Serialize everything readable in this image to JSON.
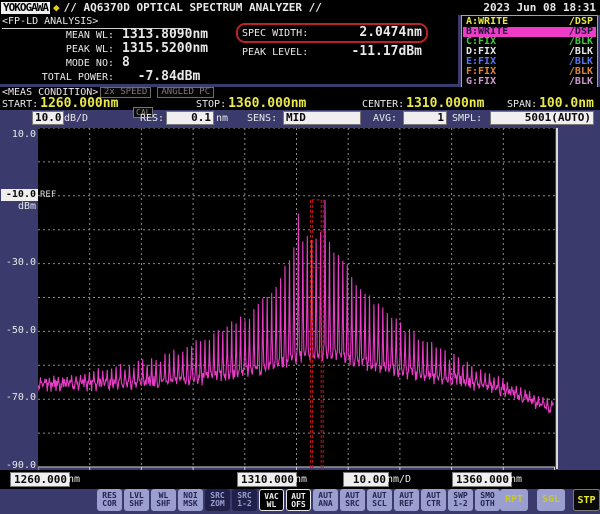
{
  "header": {
    "brand": "YOKOGAWA",
    "brand_diamond": "◆",
    "title": "// AQ6370D OPTICAL SPECTRUM ANALYZER //",
    "datetime": "2023 Jun 08 18:31"
  },
  "analysis": {
    "title": "<FP-LD ANALYSIS>",
    "fields_left": [
      {
        "label": "MEAN WL:",
        "value": "1313.8090nm"
      },
      {
        "label": "PEAK WL:",
        "value": "1315.5200nm"
      },
      {
        "label": "MODE NO:",
        "value": "8"
      },
      {
        "label": "TOTAL POWER:",
        "value": "  -7.84dBm"
      }
    ],
    "fields_right": [
      {
        "label": "SPEC WIDTH:",
        "value": "2.0474nm",
        "highlighted": true
      },
      {
        "label": "PEAK LEVEL:",
        "value": "-11.17dBm"
      }
    ],
    "highlight_color": "#b92222"
  },
  "trace_menu": {
    "items": [
      {
        "label": "A:WRITE",
        "mode": "/DSP",
        "color": "#e8e848"
      },
      {
        "label": "B:WRITE",
        "mode": "/DSP",
        "color": "#181838",
        "bg": "#ee3cc8",
        "active": true
      },
      {
        "label": "C:FIX",
        "mode": "/BLK",
        "color": "#3ecc3e"
      },
      {
        "label": "D:FIX",
        "mode": "/BLK",
        "color": "#e8e8e8"
      },
      {
        "label": "E:FIX",
        "mode": "/BLK",
        "color": "#5577ee"
      },
      {
        "label": "F:FIX",
        "mode": "/BLK",
        "color": "#dd8833"
      },
      {
        "label": "G:FIX",
        "mode": "/BLK",
        "color": "#cc99cc"
      }
    ]
  },
  "meas_condition": {
    "title": "<MEAS CONDITION>",
    "flags": [
      "2x SPEED",
      "ANGLED PC"
    ],
    "params": [
      {
        "label": "START:",
        "value": "1260.000nm"
      },
      {
        "label": "STOP:",
        "value": "1360.000nm"
      },
      {
        "label": "CENTER:",
        "value": "1310.000nm"
      },
      {
        "label": "SPAN:",
        "value": "100.0nm"
      }
    ]
  },
  "settings": {
    "level_scale_value": "10.0",
    "level_scale_unit": "dB/D",
    "cal_flag": "CAL",
    "res_label": "RES:",
    "res_value": "0.1",
    "res_unit": "nm",
    "sens_label": "SENS:",
    "sens_value": "MID",
    "avg_label": "AVG:",
    "avg_value": "1",
    "smpl_label": "SMPL:",
    "smpl_value": "5001(AUTO)"
  },
  "chart": {
    "y_axis_labels": [
      "10.0",
      "-10.0",
      "-30.0",
      "-50.0",
      "-70.0",
      "-90.0"
    ],
    "y_unit": "dBm",
    "ref_label": "REF"
  },
  "x_axis": {
    "start_value": "1260.000",
    "start_unit": "nm",
    "center_value": "1310.000",
    "center_unit": "nm",
    "per_div_value": "10.00",
    "per_div_unit": "nm/D",
    "stop_value": "1360.000",
    "stop_unit": "nm"
  },
  "softkeys": [
    {
      "l1": "RES",
      "l2": "COR",
      "state": "normal"
    },
    {
      "l1": "LVL",
      "l2": "SHF",
      "state": "normal"
    },
    {
      "l1": "WL",
      "l2": "SHF",
      "state": "normal"
    },
    {
      "l1": "NOI",
      "l2": "MSK",
      "state": "normal"
    },
    {
      "l1": "SRC",
      "l2": "ZOM",
      "state": "inverted"
    },
    {
      "l1": "SRC",
      "l2": "1-2",
      "state": "inverted"
    },
    {
      "l1": "VAC",
      "l2": "WL",
      "state": "selected"
    },
    {
      "l1": "AUT",
      "l2": "OFS",
      "state": "selected"
    },
    {
      "l1": "AUT",
      "l2": "ANA",
      "state": "normal"
    },
    {
      "l1": "AUT",
      "l2": "SRC",
      "state": "normal"
    },
    {
      "l1": "AUT",
      "l2": "SCL",
      "state": "normal"
    },
    {
      "l1": "AUT",
      "l2": "REF",
      "state": "normal"
    },
    {
      "l1": "AUT",
      "l2": "CTR",
      "state": "normal"
    },
    {
      "l1": "SWP",
      "l2": "1-2",
      "state": "normal"
    },
    {
      "l1": "SMO",
      "l2": "OTH",
      "state": "normal"
    }
  ],
  "sweep_keys": {
    "repeat": "RPT",
    "single": "SGL",
    "stop": "STP",
    "stop_active": true
  },
  "chart_data": {
    "type": "line",
    "title": "FP-LD optical spectrum, active trace B (WRITE)",
    "x_unit": "nm",
    "y_unit": "dBm",
    "x_range": [
      1260,
      1360
    ],
    "y_range": [
      -90,
      10
    ],
    "x_div_nm": 10,
    "y_div_db": 10,
    "ref_level_dbm": -10,
    "scale_db_per_div": 10,
    "grid": true,
    "trace_color": "#e93cc8",
    "grid_color": "#8a8a8a",
    "marker_color": "#cc1515",
    "peak": {
      "wl_nm": 1315.52,
      "level_dbm": -11.17
    },
    "mean_wl_nm": 1313.809,
    "spec_width_nm": 2.0474,
    "markers": {
      "left_nm": 1312.93,
      "right_nm": 1314.98,
      "top_dbm": -11.2,
      "threshold_dbm": -31.2
    },
    "comb": {
      "spacing_nm": 0.86,
      "anchor_nm": 1315.52
    },
    "envelope_points": [
      [
        1260,
        -64
      ],
      [
        1266,
        -63
      ],
      [
        1272,
        -61.5
      ],
      [
        1278,
        -60
      ],
      [
        1284,
        -57.5
      ],
      [
        1290,
        -54
      ],
      [
        1296,
        -50
      ],
      [
        1301,
        -45
      ],
      [
        1305,
        -39
      ],
      [
        1308,
        -31
      ],
      [
        1309.7,
        -25.5
      ],
      [
        1310.36,
        -16.2
      ],
      [
        1311,
        -23.5
      ],
      [
        1312,
        -22.5
      ],
      [
        1313,
        -21.5
      ],
      [
        1314,
        -21.8
      ],
      [
        1314.9,
        -19.5
      ],
      [
        1315.52,
        -11.17
      ],
      [
        1316.3,
        -23.5
      ],
      [
        1317.5,
        -26.5
      ],
      [
        1319,
        -30
      ],
      [
        1321,
        -34
      ],
      [
        1324,
        -39
      ],
      [
        1328,
        -45
      ],
      [
        1332,
        -50
      ],
      [
        1336,
        -54
      ],
      [
        1340,
        -57.5
      ],
      [
        1344,
        -60.5
      ],
      [
        1348,
        -63
      ],
      [
        1352,
        -66
      ],
      [
        1356,
        -68.5
      ],
      [
        1360,
        -71
      ]
    ],
    "valley_points": [
      [
        1260,
        -66
      ],
      [
        1280,
        -65.5
      ],
      [
        1295,
        -63.5
      ],
      [
        1305,
        -61
      ],
      [
        1310,
        -58
      ],
      [
        1316,
        -57
      ],
      [
        1322,
        -59
      ],
      [
        1330,
        -62
      ],
      [
        1340,
        -64.5
      ],
      [
        1348,
        -66.5
      ],
      [
        1356,
        -71
      ],
      [
        1360,
        -73
      ]
    ]
  }
}
